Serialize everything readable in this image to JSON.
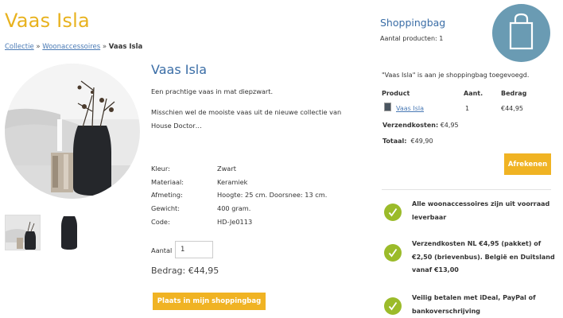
{
  "page": {
    "title": "Vaas Isla",
    "breadcrumb": {
      "item1": "Collectie",
      "sep": "»",
      "item2": "Woonaccessoires",
      "current": "Vaas Isla"
    }
  },
  "product": {
    "name": "Vaas Isla",
    "description_1": "Een prachtige vaas in mat diepzwart.",
    "description_2": "Misschien wel de  mooiste vaas uit de nieuwe collectie van House Doctor…",
    "specs": [
      {
        "label": "Kleur:",
        "value": "Zwart"
      },
      {
        "label": "Materiaal:",
        "value": "Keramiek"
      },
      {
        "label": "Afmeting:",
        "value": "Hoogte: 25 cm. Doorsnee: 13 cm."
      },
      {
        "label": "Gewicht:",
        "value": "400 gram."
      },
      {
        "label": "Code:",
        "value": "HD-Je0113"
      }
    ],
    "quantity_label": "Aantal",
    "quantity_value": "1",
    "amount": "Bedrag: €44,95",
    "add_button": "Plaats in mijn shoppingbag"
  },
  "bag": {
    "title": "Shoppingbag",
    "count": "Aantal producten: 1",
    "icon": "shopping-bag-icon",
    "added_message": "\"Vaas Isla\" is aan je shoppingbag toegevoegd.",
    "headers": {
      "product": "Product",
      "qty": "Aant.",
      "amount": "Bedrag"
    },
    "items": [
      {
        "name": "Vaas Isla",
        "qty": "1",
        "amount": "€44,95"
      }
    ],
    "shipping_label": "Verzendkosten:",
    "shipping_value": "€4,95",
    "total_label": "Totaal:",
    "total_value": "€49,90",
    "checkout_button": "Afrekenen"
  },
  "usps": [
    "Alle woonaccessoires zijn uit voorraad leverbaar",
    "Verzendkosten NL €4,95 (pakket) of €2,50 (brievenbus). België en Duitsland vanaf €13,00",
    "Veilig betalen met iDeal, PayPal of bankoverschrijving"
  ],
  "colors": {
    "accent": "#f0b323",
    "link": "#4a7ab5",
    "check": "#9bbb2a",
    "bag_circle": "#6a9bb3"
  }
}
